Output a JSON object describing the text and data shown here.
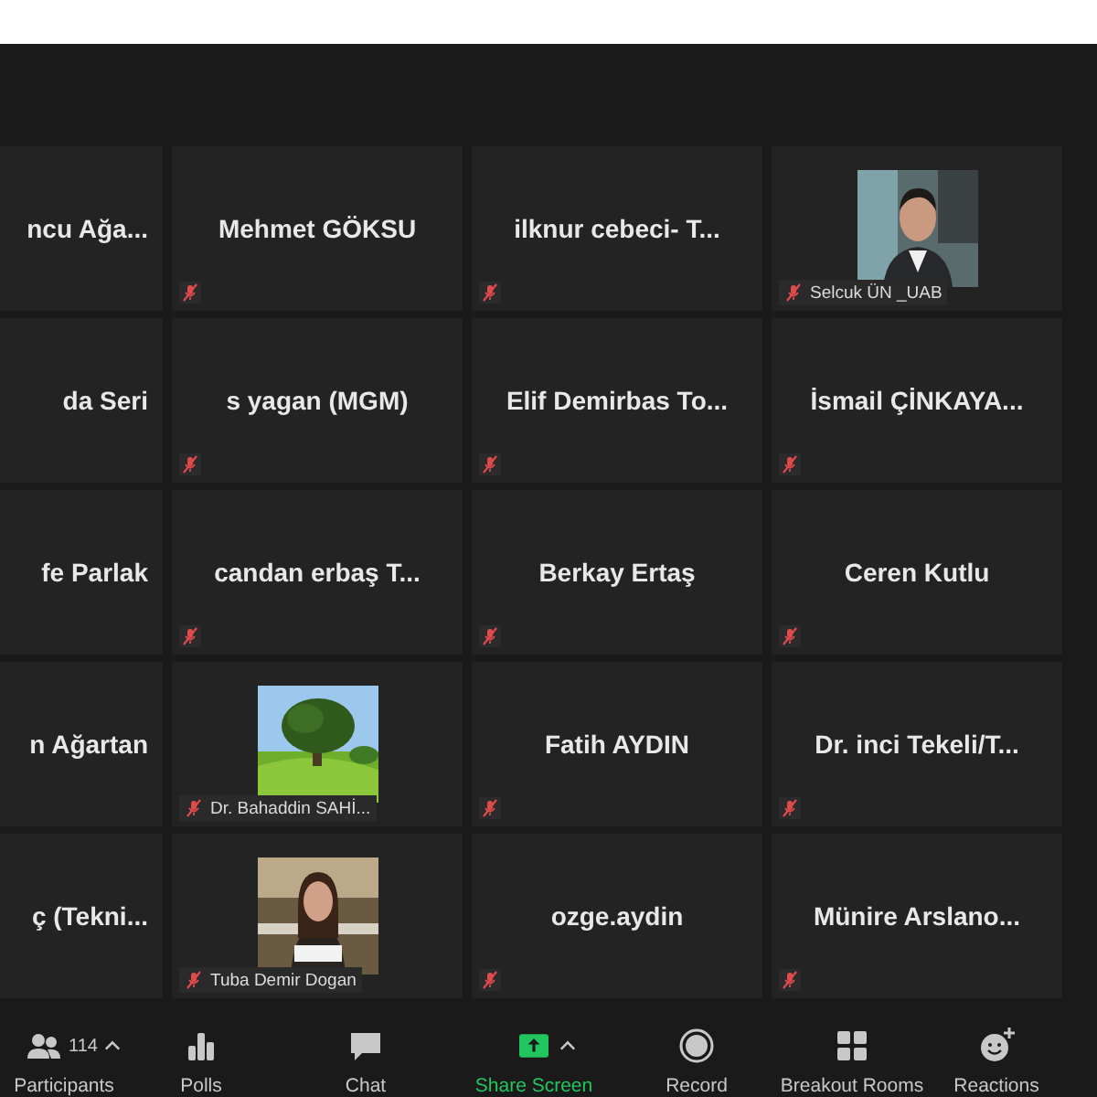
{
  "tiles": [
    {
      "kind": "name",
      "name": "ncu Ağa..."
    },
    {
      "kind": "name",
      "name": "Mehmet GÖKSU",
      "muted": true
    },
    {
      "kind": "name",
      "name": "ilknur cebeci- T...",
      "muted": true
    },
    {
      "kind": "picture",
      "name": "Selcuk ÜN _UAB",
      "muted": true
    },
    {
      "kind": "name",
      "name": "da Seri"
    },
    {
      "kind": "name",
      "name": "s yagan (MGM)",
      "muted": true
    },
    {
      "kind": "name",
      "name": "Elif Demirbas To...",
      "muted": true
    },
    {
      "kind": "name",
      "name": "İsmail ÇİNKAYA...",
      "muted": true
    },
    {
      "kind": "name",
      "name": "fe Parlak"
    },
    {
      "kind": "name",
      "name": "candan erbaş T...",
      "muted": true
    },
    {
      "kind": "name",
      "name": "Berkay Ertaş",
      "muted": true
    },
    {
      "kind": "name",
      "name": "Ceren Kutlu",
      "muted": true
    },
    {
      "kind": "name",
      "name": "n Ağartan"
    },
    {
      "kind": "picture",
      "name": "Dr. Bahaddin SAHİ...",
      "muted": true
    },
    {
      "kind": "name",
      "name": "Fatih AYDIN",
      "muted": true
    },
    {
      "kind": "name",
      "name": "Dr. inci Tekeli/T...",
      "muted": true
    },
    {
      "kind": "name",
      "name": "ç (Tekni..."
    },
    {
      "kind": "picture",
      "name": "Tuba Demir Dogan",
      "muted": true
    },
    {
      "kind": "name",
      "name": "ozge.aydin",
      "muted": true
    },
    {
      "kind": "name",
      "name": "Münire Arslano...",
      "muted": true
    }
  ],
  "toolbar": [
    {
      "kind": "participants",
      "label": "Participants",
      "count": "114",
      "caret": true
    },
    {
      "kind": "polls",
      "label": "Polls",
      "caret": false
    },
    {
      "kind": "chat",
      "label": "Chat",
      "caret": false
    },
    {
      "kind": "share",
      "label": "Share Screen",
      "caret": true
    },
    {
      "kind": "record",
      "label": "Record",
      "caret": false
    },
    {
      "kind": "breakout",
      "label": "Breakout Rooms",
      "caret": false
    },
    {
      "kind": "reactions",
      "label": "Reactions",
      "caret": false
    }
  ]
}
